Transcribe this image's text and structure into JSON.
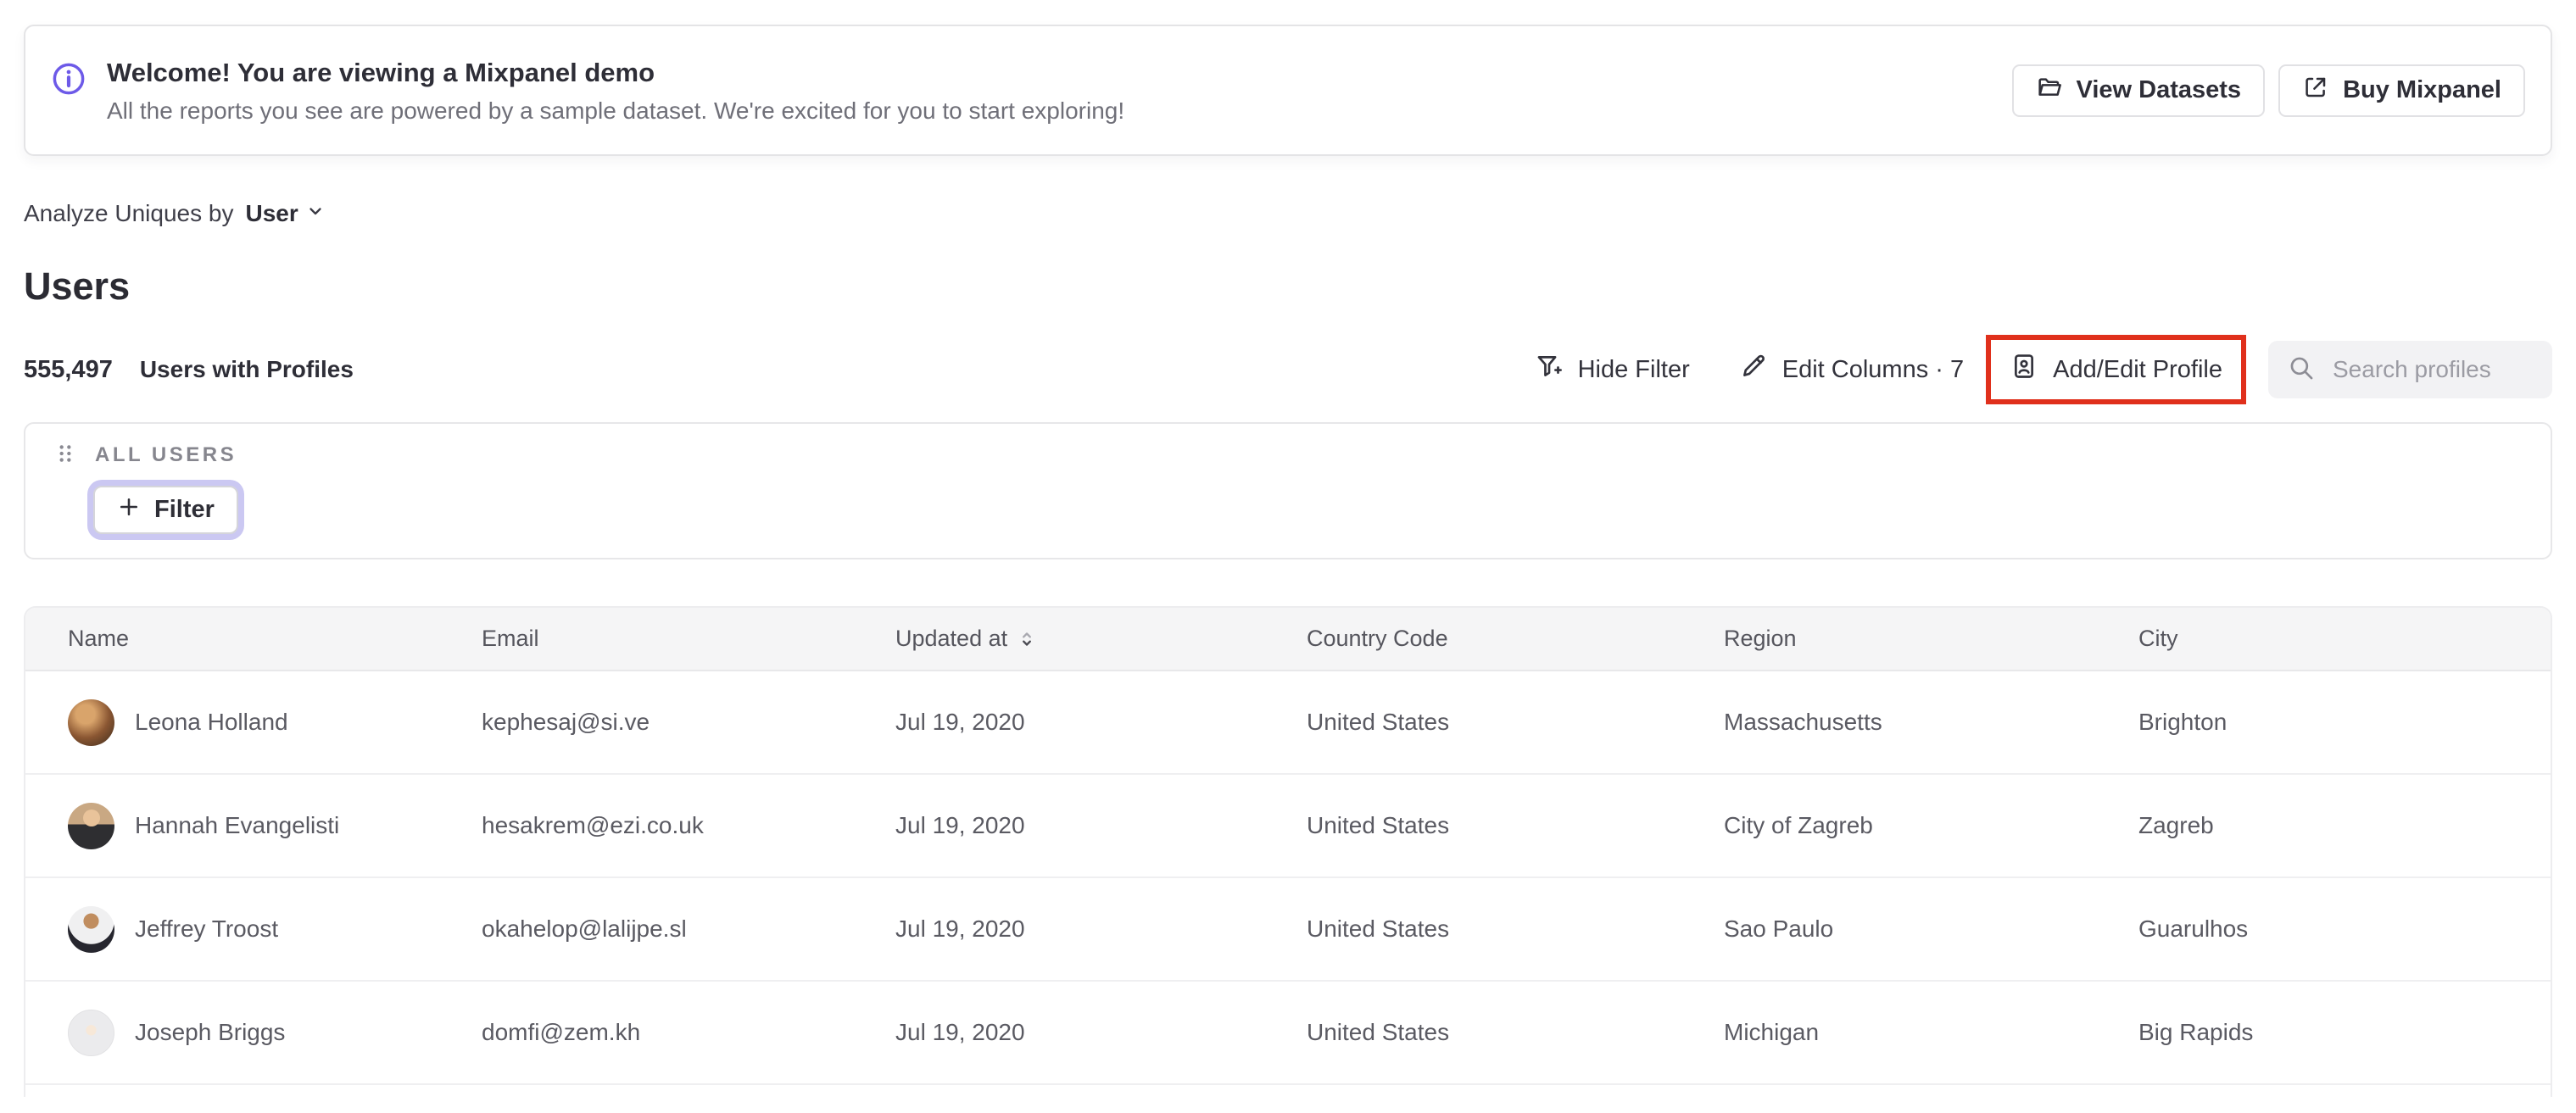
{
  "colors": {
    "accent": "#6d5ae8",
    "highlight-red": "#e0301c",
    "ring": "#cbc8f2"
  },
  "banner": {
    "title": "Welcome! You are viewing a Mixpanel demo",
    "subtitle": "All the reports you see are powered by a sample dataset. We're excited for you to start exploring!",
    "view_datasets_label": "View Datasets",
    "buy_mixpanel_label": "Buy Mixpanel"
  },
  "controls": {
    "analyze_label": "Analyze Uniques by",
    "analyze_value": "User"
  },
  "page": {
    "title": "Users",
    "count": "555,497",
    "count_label": "Users with Profiles"
  },
  "toolbar": {
    "hide_filter_label": "Hide Filter",
    "edit_columns_label": "Edit Columns · 7",
    "add_edit_profile_label": "Add/Edit Profile",
    "search_placeholder": "Search profiles"
  },
  "filter_panel": {
    "group_label": "ALL USERS",
    "filter_button_label": "Filter"
  },
  "table": {
    "columns": {
      "name": "Name",
      "email": "Email",
      "updated": "Updated at",
      "country": "Country Code",
      "region": "Region",
      "city": "City"
    },
    "rows": [
      {
        "name": "Leona Holland",
        "email": "kephesaj@si.ve",
        "updated": "Jul 19, 2020",
        "country": "United States",
        "region": "Massachusetts",
        "city": "Brighton",
        "avatar": "avatar-leona"
      },
      {
        "name": "Hannah Evangelisti",
        "email": "hesakrem@ezi.co.uk",
        "updated": "Jul 19, 2020",
        "country": "United States",
        "region": "City of Zagreb",
        "city": "Zagreb",
        "avatar": "avatar-hannah"
      },
      {
        "name": "Jeffrey Troost",
        "email": "okahelop@lalijpe.sl",
        "updated": "Jul 19, 2020",
        "country": "United States",
        "region": "Sao Paulo",
        "city": "Guarulhos",
        "avatar": "avatar-jeffrey"
      },
      {
        "name": "Joseph Briggs",
        "email": "domfi@zem.kh",
        "updated": "Jul 19, 2020",
        "country": "United States",
        "region": "Michigan",
        "city": "Big Rapids",
        "avatar": "avatar-joseph"
      }
    ]
  }
}
